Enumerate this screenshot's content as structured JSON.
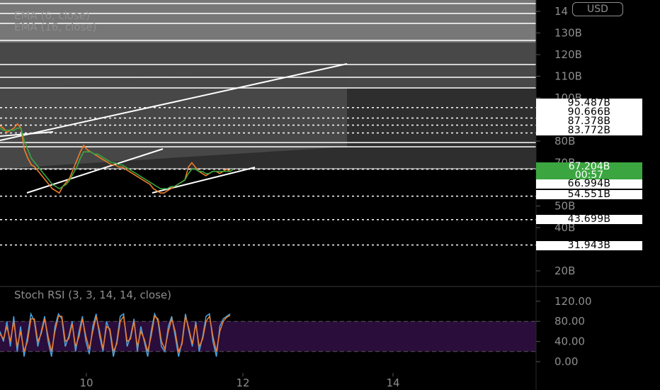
{
  "currency": "USD",
  "legend_main": [
    "EMA (6, close)",
    "EMA (16, close)"
  ],
  "legend_stoch": "Stoch RSI (3, 3, 14, 14, close)",
  "colors": {
    "up": "#3ba640",
    "series_blue": "#4aa3df",
    "series_orange": "#f07d2a",
    "stoch_band": "#2a0d3a"
  },
  "chart_data": [
    {
      "type": "line",
      "x_ticks": [
        "10",
        "12",
        "14"
      ],
      "y_ticks": [
        "14",
        "130B",
        "120B",
        "110B",
        "100B",
        "80B",
        "70B",
        "50B",
        "40B",
        "20B"
      ],
      "y_tick_values": [
        140,
        130,
        120,
        110,
        100,
        80,
        70,
        50,
        40,
        20
      ],
      "ylim": [
        10,
        143
      ],
      "current_price": {
        "value": "67.204B",
        "countdown": "00:57"
      },
      "price_levels": [
        "95.487B",
        "90.666B",
        "87.378B",
        "83.772B",
        "66.994B",
        "54.551B",
        "43.699B",
        "31.943B"
      ],
      "price_level_values": [
        95.487,
        90.666,
        87.378,
        83.772,
        66.994,
        54.551,
        43.699,
        31.943
      ],
      "series": [
        {
          "values": [
            87,
            86,
            84,
            85,
            86,
            88,
            86,
            76,
            72,
            69,
            68,
            66,
            64,
            62,
            60,
            58,
            57,
            56,
            59,
            61,
            63,
            67,
            71,
            75,
            78,
            76,
            75,
            74,
            73,
            72,
            71,
            70,
            69,
            69,
            68,
            68,
            67,
            66,
            65,
            64,
            63,
            62,
            61,
            60,
            58,
            57,
            56,
            56,
            57,
            58,
            59,
            60,
            61,
            62,
            68,
            70,
            68,
            66,
            65,
            64,
            65,
            66,
            66,
            65,
            66,
            67,
            66,
            67
          ]
        },
        {
          "values": [
            86,
            85,
            85,
            85,
            85,
            86,
            86,
            80,
            76,
            72,
            70,
            68,
            66,
            64,
            62,
            60,
            59,
            58,
            59,
            60,
            62,
            65,
            68,
            72,
            75,
            75,
            75,
            74,
            74,
            73,
            72,
            71,
            70,
            70,
            69,
            69,
            68,
            67,
            66,
            65,
            64,
            63,
            62,
            61,
            60,
            59,
            58,
            58,
            58,
            59,
            59,
            60,
            61,
            62,
            65,
            67,
            67,
            66,
            66,
            65,
            65,
            66,
            66,
            66,
            66,
            66,
            66,
            67
          ]
        }
      ]
    },
    {
      "type": "line",
      "y_ticks": [
        "120.00",
        "80.00",
        "40.00",
        "0.00"
      ],
      "y_tick_values": [
        120,
        80,
        40,
        0
      ],
      "ylim": [
        -10,
        130
      ],
      "band": [
        20,
        80
      ],
      "series": [
        {
          "values": [
            60,
            40,
            80,
            30,
            90,
            20,
            70,
            10,
            50,
            95,
            80,
            30,
            60,
            90,
            40,
            10,
            70,
            95,
            85,
            30,
            50,
            80,
            20,
            60,
            90,
            40,
            15,
            70,
            95,
            50,
            20,
            80,
            60,
            10,
            40,
            90,
            95,
            30,
            50,
            85,
            20,
            70,
            40,
            10,
            60,
            95,
            80,
            30,
            20,
            70,
            90,
            50,
            10,
            40,
            95,
            60,
            30,
            80,
            20,
            50,
            90,
            95,
            40,
            10,
            70,
            85,
            90,
            95
          ]
        },
        {
          "values": [
            55,
            45,
            70,
            40,
            80,
            30,
            60,
            20,
            40,
            85,
            85,
            40,
            55,
            85,
            50,
            20,
            60,
            90,
            90,
            40,
            45,
            75,
            30,
            50,
            85,
            50,
            25,
            60,
            90,
            60,
            25,
            70,
            65,
            20,
            35,
            80,
            90,
            40,
            45,
            80,
            30,
            60,
            45,
            20,
            50,
            90,
            85,
            40,
            25,
            60,
            85,
            60,
            20,
            35,
            90,
            65,
            35,
            75,
            30,
            45,
            80,
            90,
            50,
            20,
            60,
            80,
            88,
            92
          ]
        }
      ]
    }
  ]
}
